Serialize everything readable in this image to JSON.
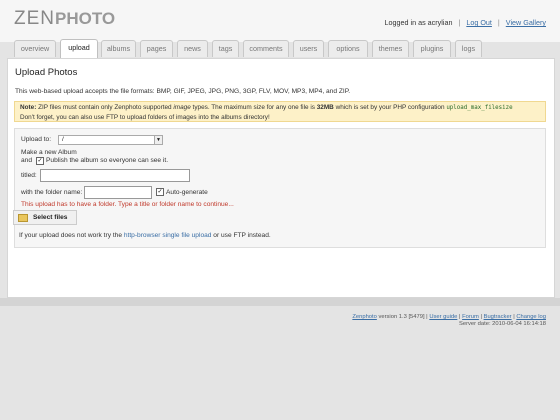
{
  "header": {
    "logo_zen": "ZEN",
    "logo_photo": "PHOTO",
    "logged_in": "Logged in as acrylian",
    "logout": "Log Out",
    "view_gallery": "View Gallery"
  },
  "tabs": [
    {
      "label": "overview"
    },
    {
      "label": "upload"
    },
    {
      "label": "albums"
    },
    {
      "label": "pages"
    },
    {
      "label": "news"
    },
    {
      "label": "tags"
    },
    {
      "label": "comments"
    },
    {
      "label": "users"
    },
    {
      "label": "options"
    },
    {
      "label": "themes"
    },
    {
      "label": "plugins"
    },
    {
      "label": "logs"
    }
  ],
  "main": {
    "title": "Upload Photos",
    "intro": "This web-based upload accepts the file formats: BMP, GIF, JPEG, JPG, PNG, 3GP, FLV, MOV, MP3, MP4, and ZIP.",
    "note_label": "Note:",
    "note_text_1": "ZIP files must contain only Zenphoto supported",
    "note_image": "image",
    "note_text_2": "types. The maximum size for any one file is",
    "note_size": "32MB",
    "note_text_3": "which is set by your PHP configuration",
    "note_code": "upload_max_filesize",
    "note_line2": "Don't forget, you can also use FTP to upload folders of images into the albums directory!"
  },
  "form": {
    "upload_to_label": "Upload to:",
    "upload_to_value": "/",
    "make_album": "Make a new Album",
    "and": "and",
    "publish_label": "Publish the album so everyone can see it.",
    "titled_label": "titled:",
    "titled_value": "",
    "folder_label": "with the folder name:",
    "folder_value": "",
    "autogenerate_label": "Auto-generate",
    "error": "This upload has to have a folder. Type a title or folder name to continue..."
  },
  "select_files": "Select files",
  "fallback": {
    "prefix": "If your upload does not work try the",
    "link": "http-browser single file upload",
    "suffix": "or use FTP instead."
  },
  "footer": {
    "brand": "Zenphoto",
    "version": "version 1.3 [5479] |",
    "user_guide": "User guide",
    "forum": "Forum",
    "bugtracker": "Bugtracker",
    "changelog": "Change log",
    "server_date": "Server date: 2010-06-04 16:14:18"
  },
  "colors": {
    "accent_link": "#3a6ea5",
    "note_bg": "#fdf1c8",
    "error": "#c0392b"
  }
}
